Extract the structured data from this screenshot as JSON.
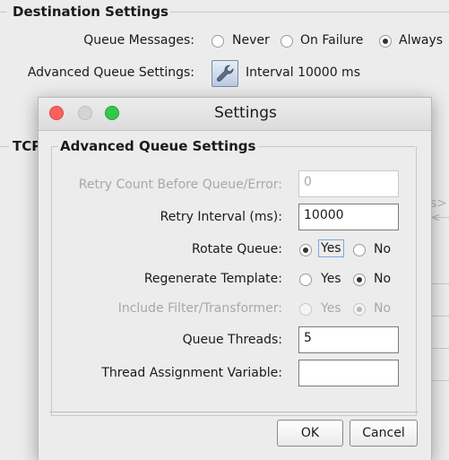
{
  "destination_settings": {
    "title": "Destination Settings",
    "queue_messages_label": "Queue Messages:",
    "queue_options": [
      "Never",
      "On Failure",
      "Always"
    ],
    "queue_selected": "Always",
    "advanced_queue_label": "Advanced Queue Settings:",
    "interval_text": "Interval 10000 ms"
  },
  "tcp_section": {
    "title_fragment": "TCP",
    "clipped_text": "s><"
  },
  "dialog": {
    "title": "Settings",
    "group_title": "Advanced Queue Settings",
    "fields": {
      "retry_count": {
        "label": "Retry Count Before Queue/Error:",
        "value": "0",
        "disabled": true
      },
      "retry_interval": {
        "label": "Retry Interval (ms):",
        "value": "10000"
      },
      "rotate_queue": {
        "label": "Rotate Queue:",
        "options": [
          "Yes",
          "No"
        ],
        "selected": "Yes"
      },
      "regenerate_template": {
        "label": "Regenerate Template:",
        "options": [
          "Yes",
          "No"
        ],
        "selected": "No"
      },
      "include_filter": {
        "label": "Include Filter/Transformer:",
        "options": [
          "Yes",
          "No"
        ],
        "selected": "No",
        "disabled": true
      },
      "queue_threads": {
        "label": "Queue Threads:",
        "value": "5"
      },
      "thread_assignment_variable": {
        "label": "Thread Assignment Variable:",
        "value": ""
      }
    },
    "buttons": {
      "ok": "OK",
      "cancel": "Cancel"
    }
  },
  "colors": {
    "traffic_close": "#fc605c",
    "traffic_minimize": "#d8d8d8",
    "traffic_maximize": "#34c84a",
    "focus_ring": "#7aa7e0"
  }
}
